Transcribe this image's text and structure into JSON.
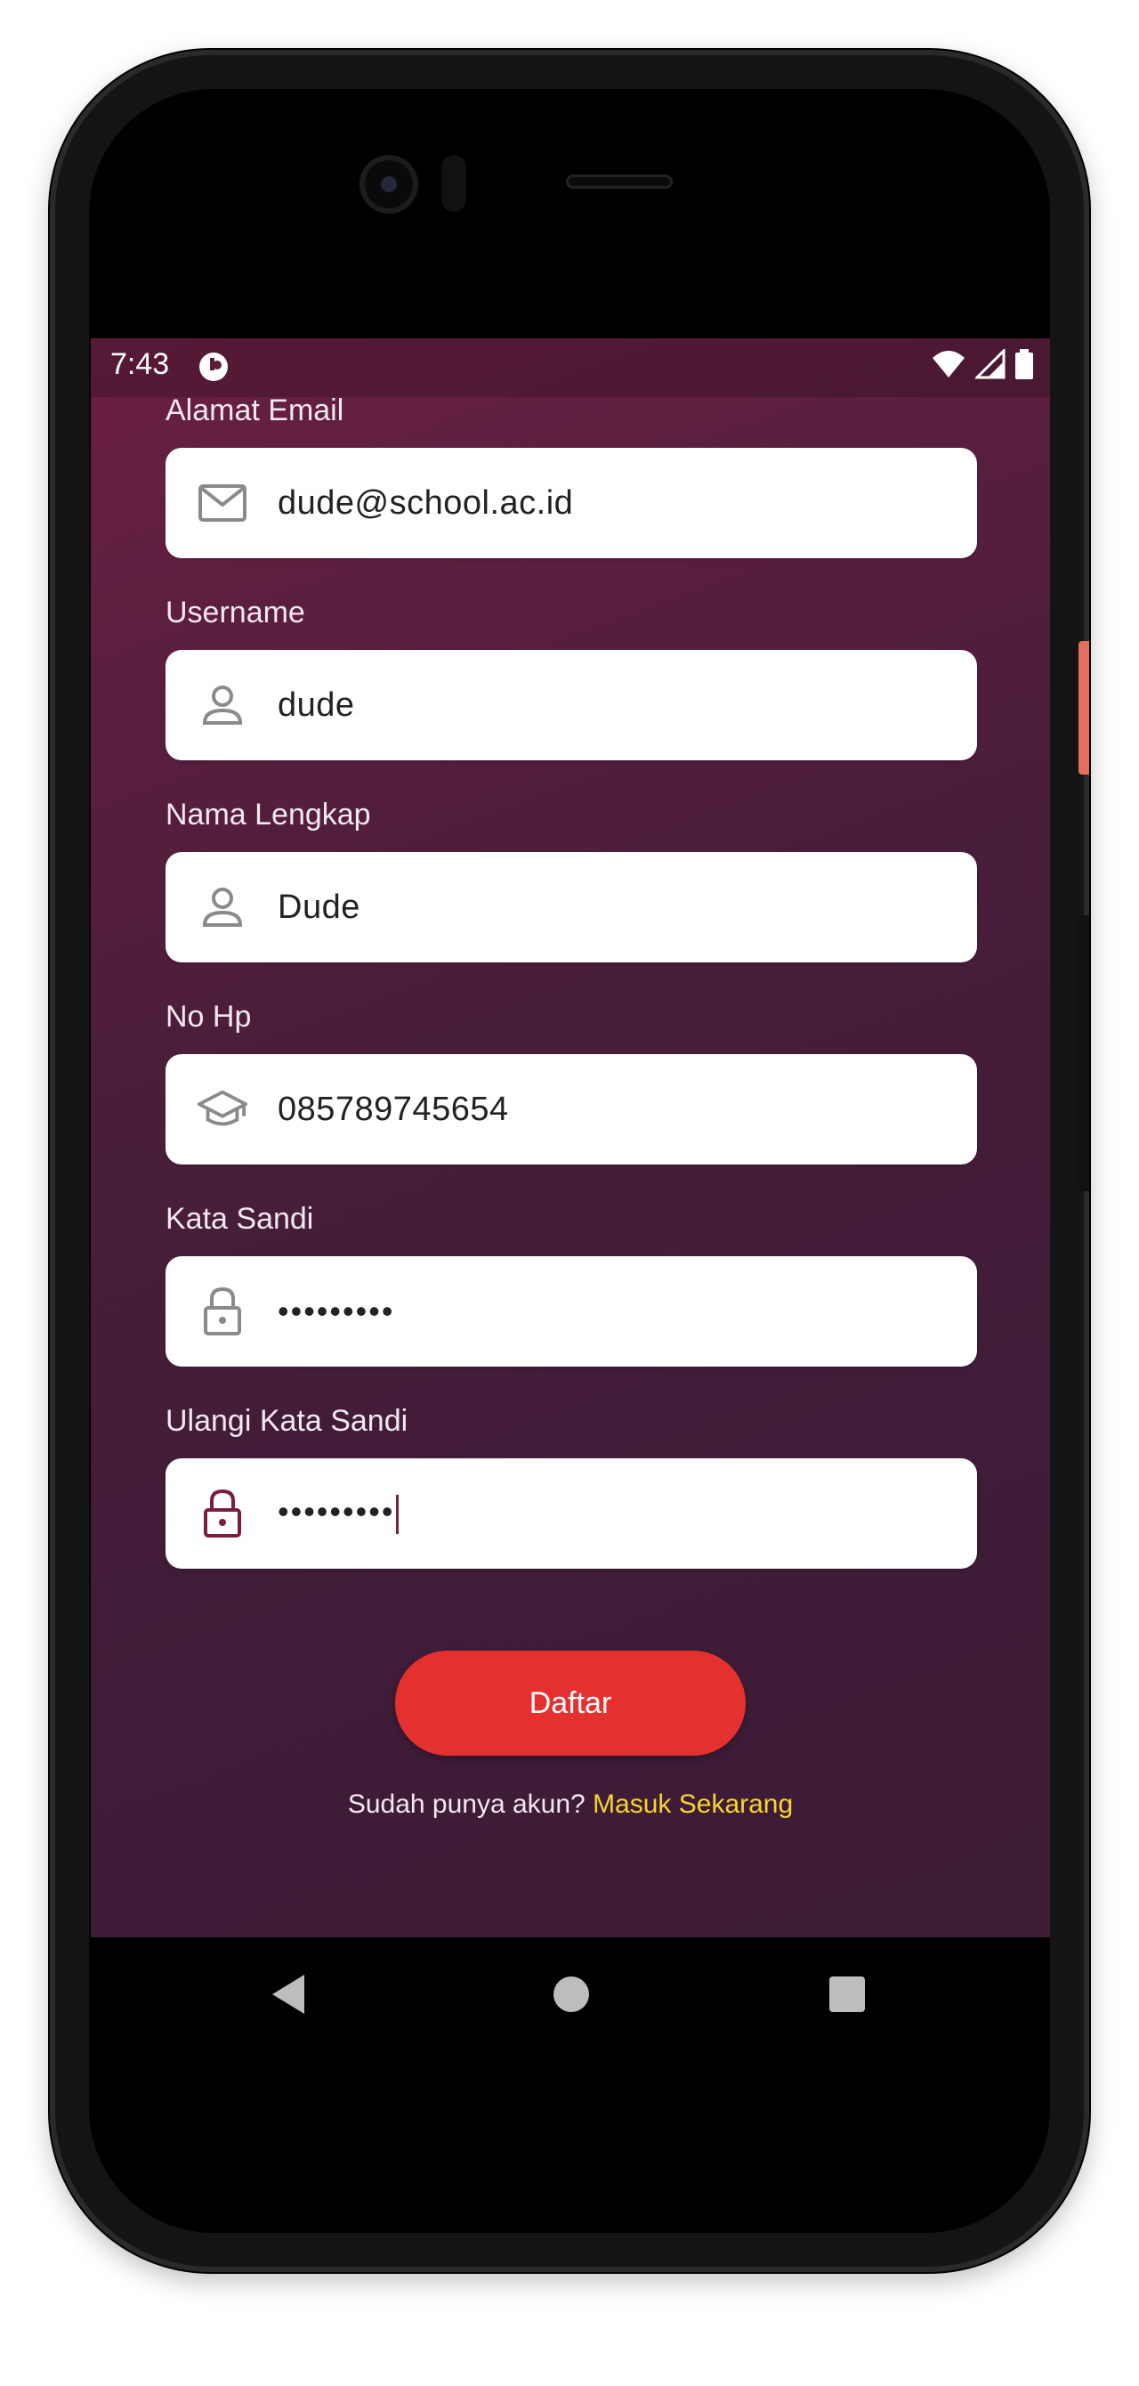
{
  "status_bar": {
    "time": "7:43"
  },
  "form": {
    "email": {
      "label": "Alamat Email",
      "value": "dude@school.ac.id",
      "icon": "mail-icon"
    },
    "username": {
      "label": "Username",
      "value": "dude",
      "icon": "person-icon"
    },
    "fullname": {
      "label": "Nama Lengkap",
      "value": "Dude",
      "icon": "person-icon"
    },
    "phone": {
      "label": "No Hp",
      "value": "085789745654",
      "icon": "graduation-cap-icon"
    },
    "password": {
      "label": "Kata Sandi",
      "value": "•••••••••",
      "icon": "lock-icon"
    },
    "password_confirm": {
      "label": "Ulangi Kata Sandi",
      "value": "•••••••••",
      "icon": "lock-icon"
    }
  },
  "actions": {
    "register_label": "Daftar",
    "login_prompt": "Sudah punya akun?",
    "login_link": "Masuk Sekarang"
  },
  "colors": {
    "background_top": "#6a1f42",
    "background_bottom": "#3d1c36",
    "button": "#e53030",
    "link": "#f5d530",
    "active_icon": "#7b1d3f"
  }
}
